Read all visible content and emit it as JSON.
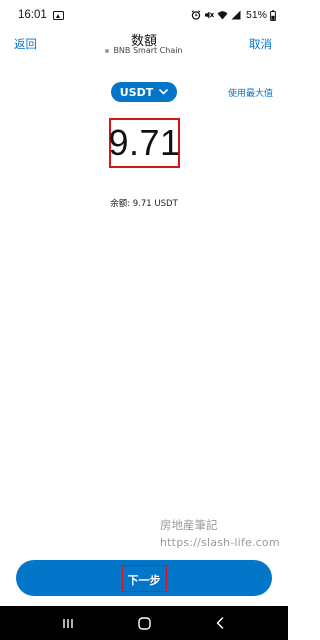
{
  "status_bar": {
    "time": "16:01",
    "battery": "51%"
  },
  "header": {
    "back_label": "返回",
    "title": "数額",
    "network": "BNB Smart Chain",
    "cancel_label": "取消"
  },
  "token": {
    "symbol": "USDT",
    "use_max_label": "使用最大值"
  },
  "amount": {
    "value": "9.71"
  },
  "balance": {
    "text": "余额: 9.71 USDT"
  },
  "watermark": {
    "line1": "房地産筆記",
    "line2": "https://slash-life.com"
  },
  "actions": {
    "next_label": "下一步"
  },
  "colors": {
    "accent": "#0376c9",
    "highlight_border": "#d6151b",
    "nav_background": "#000000"
  },
  "icons": [
    "gallery-icon",
    "alarm-icon",
    "mute-icon",
    "wifi-icon",
    "signal-icon",
    "battery-icon",
    "chevron-down-icon",
    "recents-icon",
    "home-icon",
    "back-icon"
  ]
}
